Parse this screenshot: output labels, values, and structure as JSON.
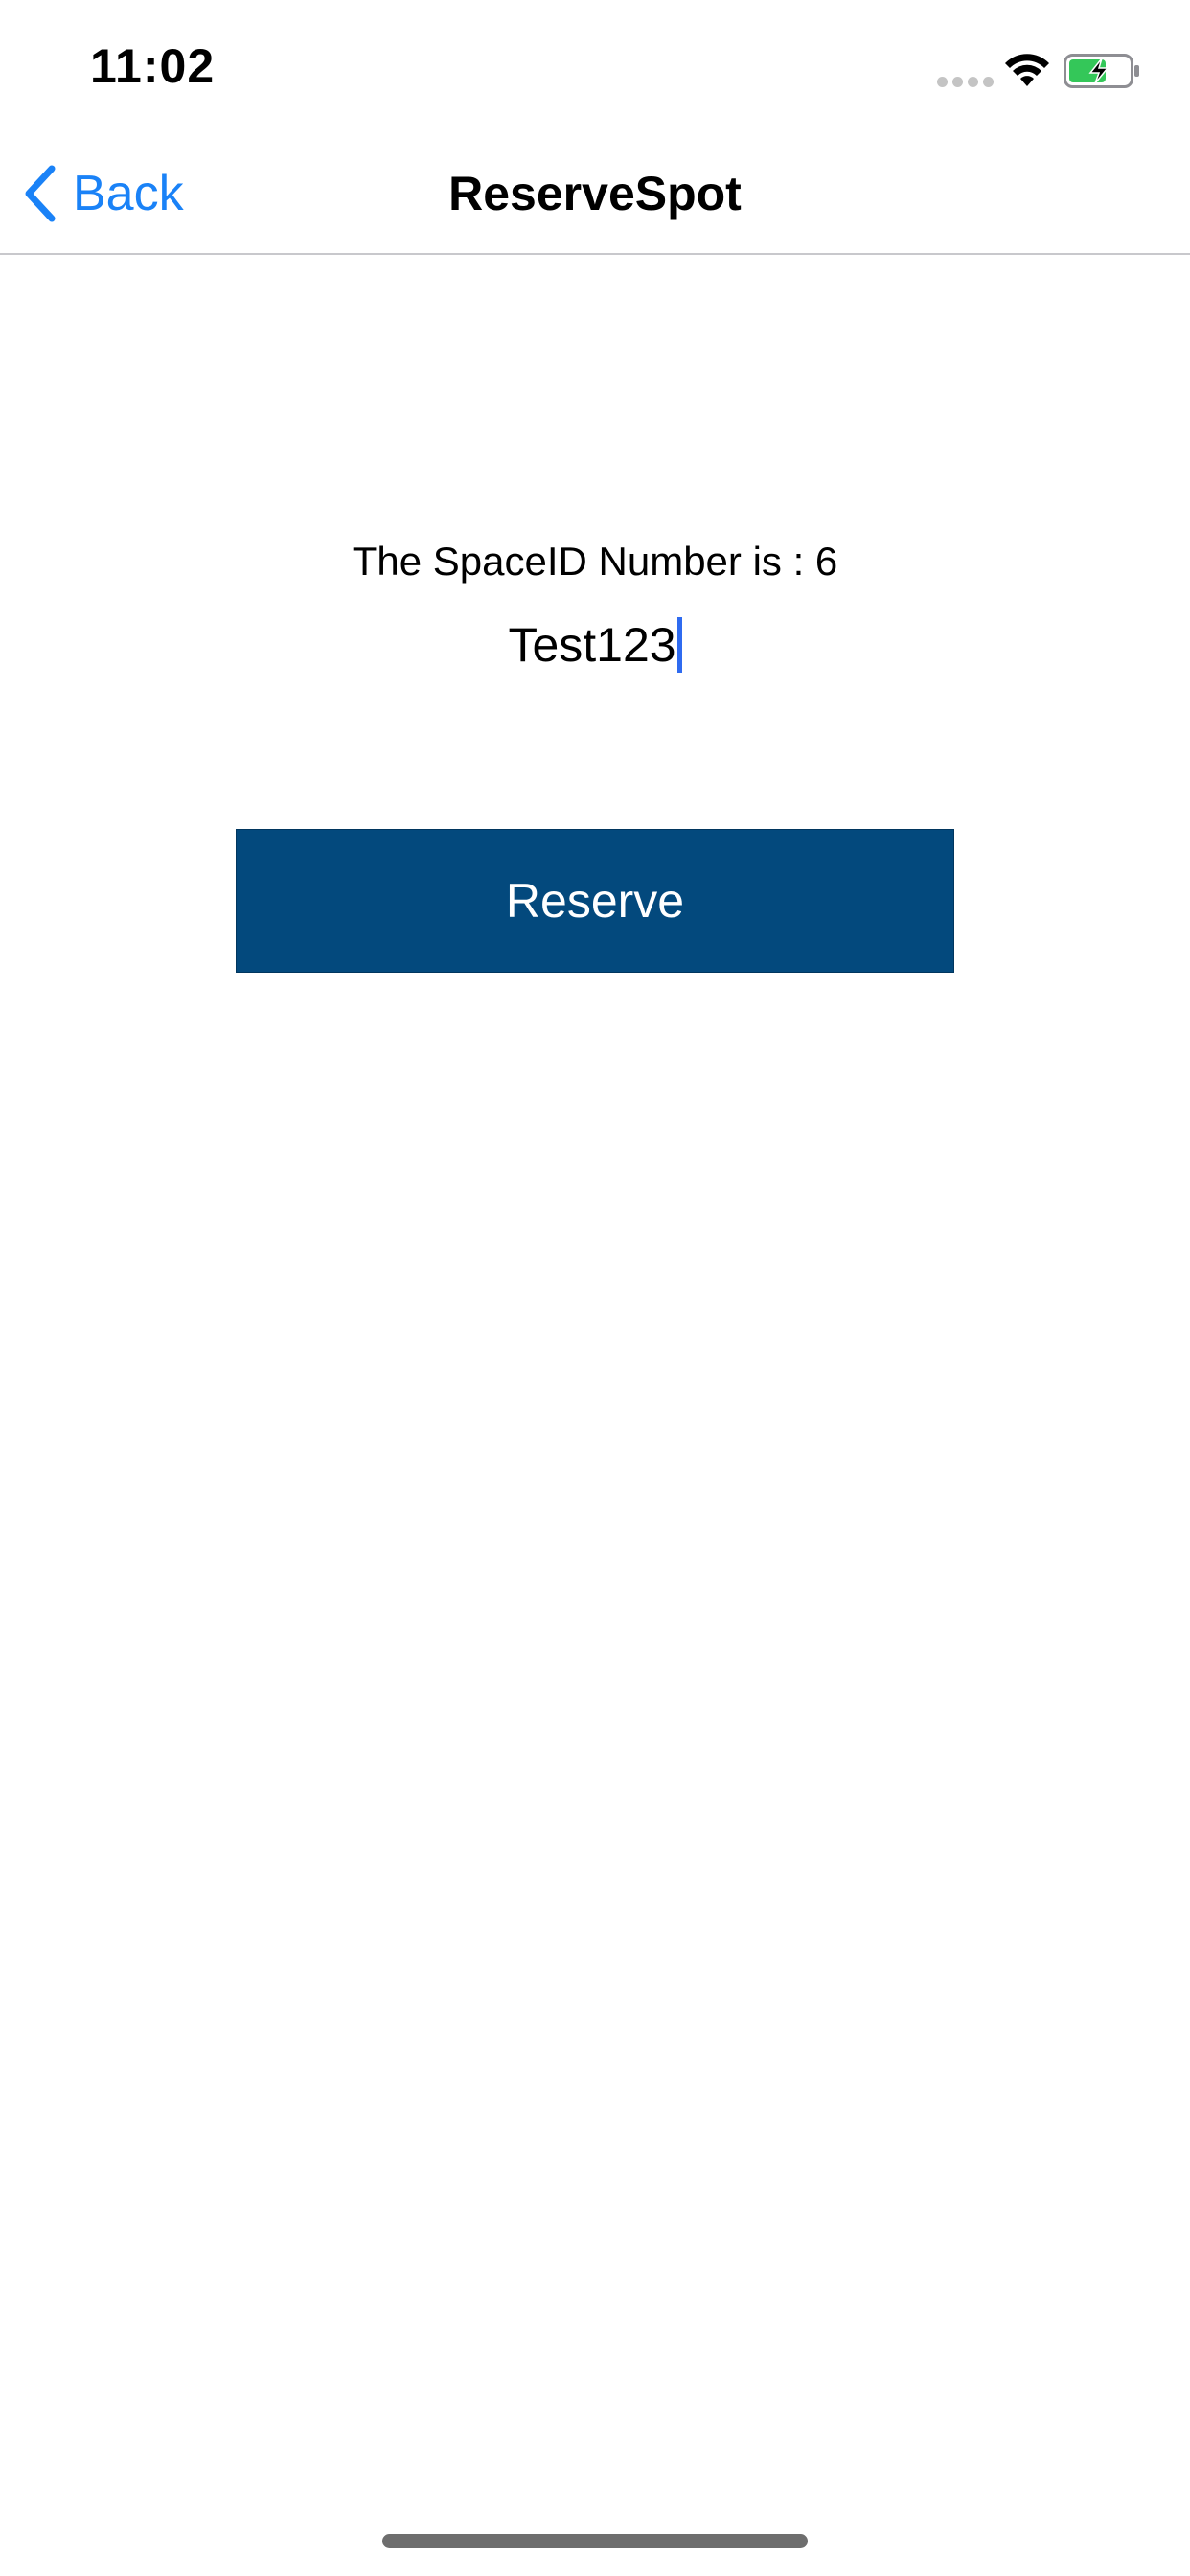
{
  "status_bar": {
    "time": "11:02",
    "icons": [
      "cellular-signal-icon",
      "wifi-icon",
      "battery-charging-icon"
    ]
  },
  "nav": {
    "back_label": "Back",
    "title": "ReserveSpot"
  },
  "content": {
    "space_label": "The SpaceID Number is : 6",
    "input_value": "Test123"
  },
  "actions": {
    "reserve_label": "Reserve"
  },
  "colors": {
    "accent": "#1a82f7",
    "button_bg": "#03497d",
    "caret": "#2f6bf0",
    "battery_fill": "#34c759"
  }
}
